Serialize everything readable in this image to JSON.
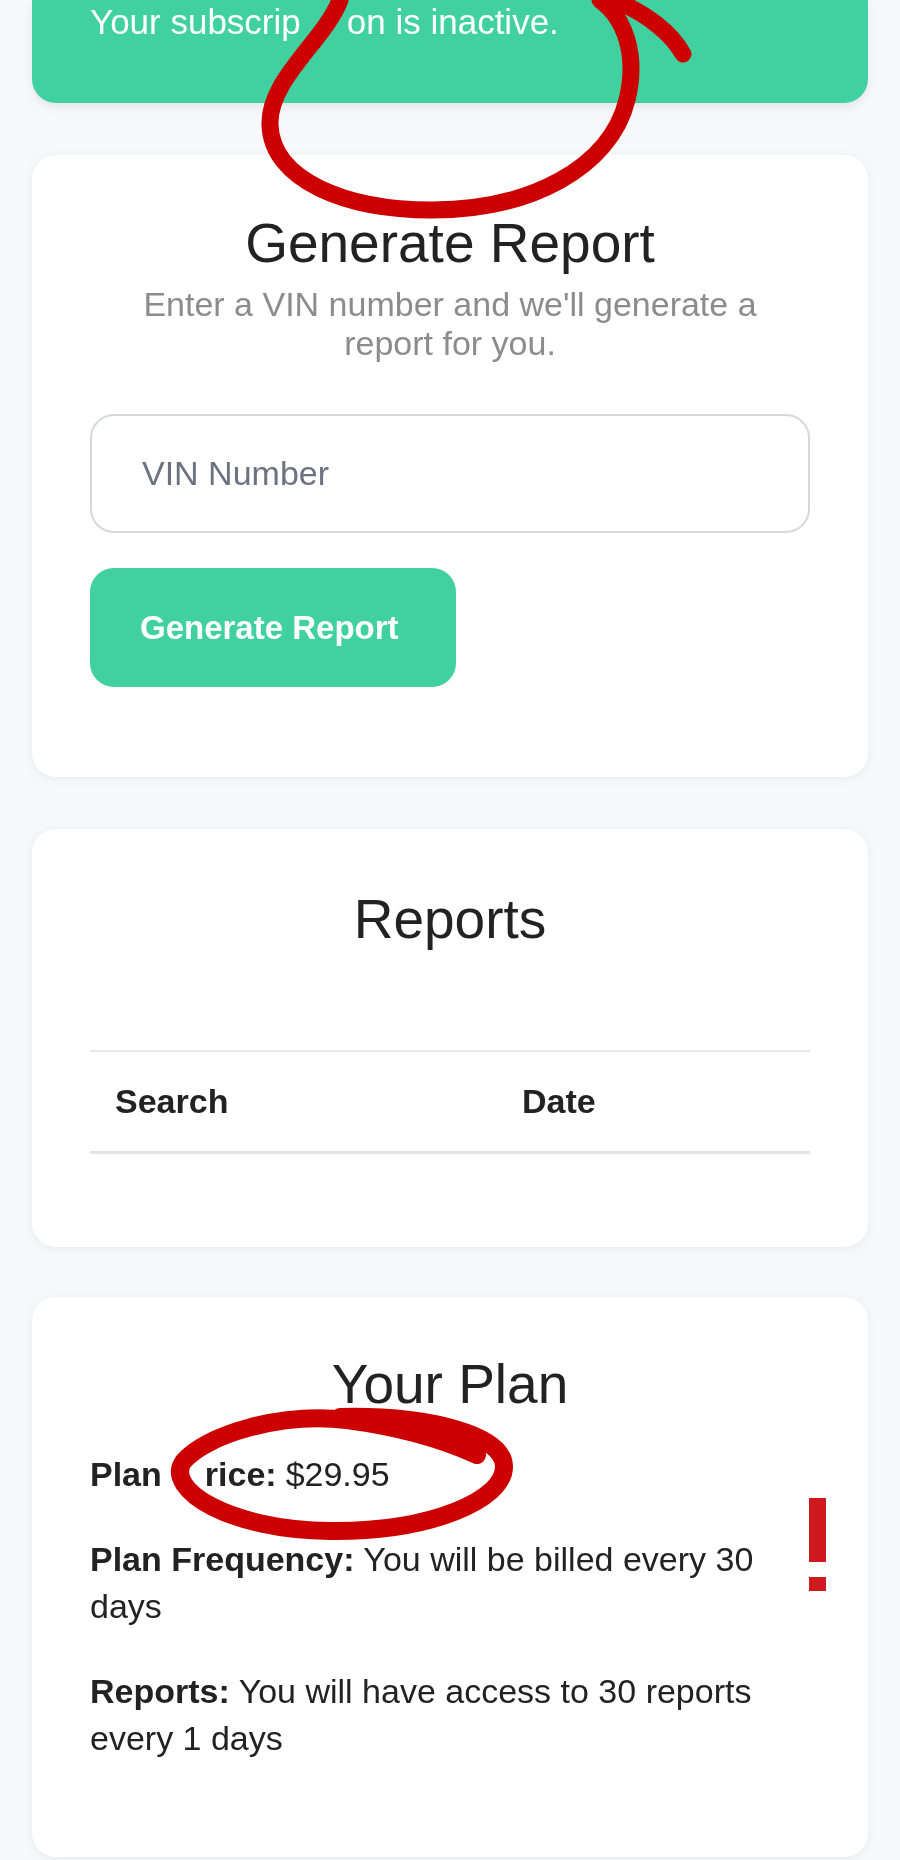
{
  "banner": {
    "message_parts": [
      "Your subscrip",
      "on is inactive."
    ]
  },
  "generate_report": {
    "title": "Generate Report",
    "subtitle": "Enter a VIN number and we'll generate a report for you.",
    "vin_field": {
      "placeholder": "VIN Number"
    },
    "button": "Generate Report"
  },
  "reports": {
    "title": "Reports",
    "table": {
      "columns": [
        "Search",
        "Date"
      ]
    }
  },
  "plan": {
    "title": "Your Plan",
    "price": {
      "label_parts": [
        "Plan",
        "rice:"
      ],
      "value": "$29.95"
    },
    "details": [
      {
        "label": "Plan Frequency:",
        "value": "You will be billed every 30 days"
      },
      {
        "label": "Reports:",
        "value": "You will have access to 30 reports every 1 days"
      }
    ]
  }
}
